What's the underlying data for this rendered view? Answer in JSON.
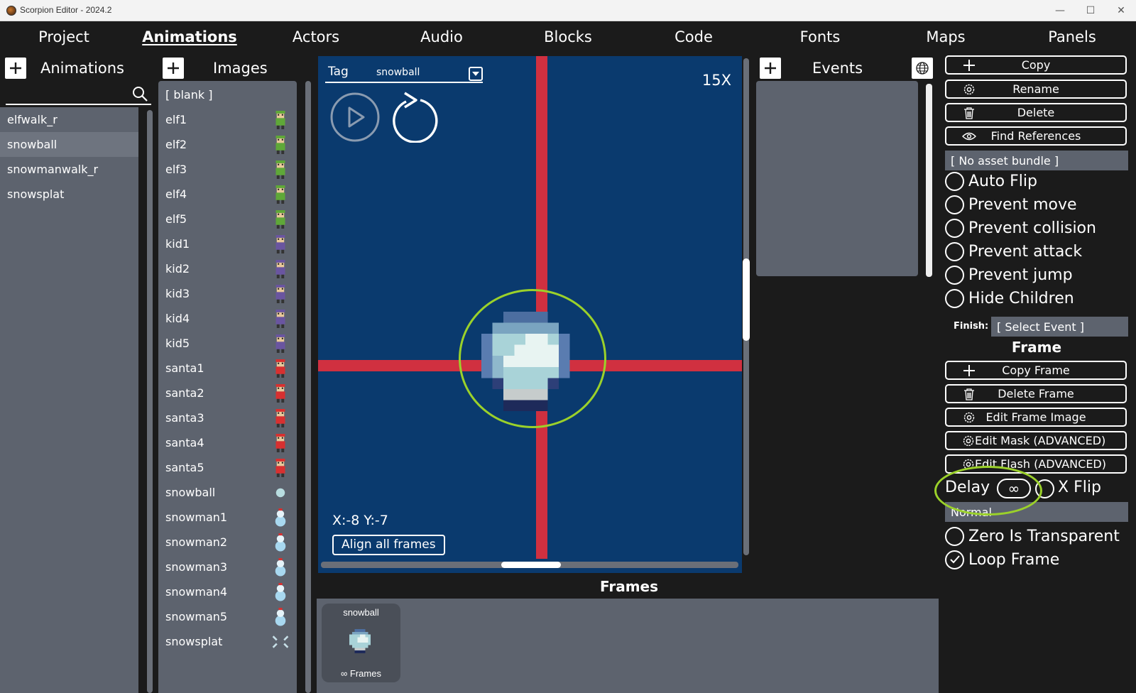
{
  "window": {
    "title": "Scorpion Editor - 2024.2",
    "minimize_glyph": "—",
    "maximize_glyph": "☐",
    "close_glyph": "✕"
  },
  "menu": [
    "Project",
    "Animations",
    "Actors",
    "Audio",
    "Blocks",
    "Code",
    "Fonts",
    "Maps",
    "Panels"
  ],
  "menu_active": "Animations",
  "animations_panel": {
    "title": "Animations",
    "items": [
      "elfwalk_r",
      "snowball",
      "snowmanwalk_r",
      "snowsplat"
    ],
    "selected": "snowball"
  },
  "images_panel": {
    "title": "Images",
    "items": [
      "[ blank ]",
      "elf1",
      "elf2",
      "elf3",
      "elf4",
      "elf5",
      "kid1",
      "kid2",
      "kid3",
      "kid4",
      "kid5",
      "santa1",
      "santa2",
      "santa3",
      "santa4",
      "santa5",
      "snowball",
      "snowman1",
      "snowman2",
      "snowman3",
      "snowman4",
      "snowman5",
      "snowsplat"
    ],
    "sprite_colors": {
      "elf": "#5fa838",
      "kid": "#6a55a0",
      "santa": "#d83030",
      "snowball": "#b8dde0",
      "snowman": "#a8d8f0",
      "snowsplat": "#c8e0e8"
    }
  },
  "canvas": {
    "tag_label": "Tag",
    "tag_value": "snowball",
    "zoom": "15X",
    "coords": "X:-8 Y:-7",
    "align_button": "Align all frames",
    "bg_color": "#0a3a6e",
    "crosshair_color": "#d03040"
  },
  "events_panel": {
    "title": "Events"
  },
  "actions": {
    "copy": "Copy",
    "rename": "Rename",
    "delete": "Delete",
    "find_references": "Find References",
    "asset_bundle": "[ No asset bundle ]"
  },
  "options": [
    {
      "label": "Auto Flip",
      "checked": false
    },
    {
      "label": "Prevent move",
      "checked": false
    },
    {
      "label": "Prevent collision",
      "checked": false
    },
    {
      "label": "Prevent attack",
      "checked": false
    },
    {
      "label": "Prevent jump",
      "checked": false
    },
    {
      "label": "Hide Children",
      "checked": false
    }
  ],
  "finish": {
    "label": "Finish:",
    "value": "[ Select Event ]"
  },
  "frame_section": {
    "title": "Frame",
    "copy_frame": "Copy Frame",
    "delete_frame": "Delete Frame",
    "edit_frame_image": "Edit Frame Image",
    "edit_mask": "Edit Mask (ADVANCED)",
    "edit_flash": "Edit Flash (ADVANCED)",
    "delay_label": "Delay",
    "delay_value": "∞",
    "xflip_label": "X Flip",
    "blend_mode": "Normal",
    "zero_transparent": {
      "label": "Zero Is Transparent",
      "checked": false
    },
    "loop_frame": {
      "label": "Loop Frame",
      "checked": true
    }
  },
  "frames_panel": {
    "title": "Frames",
    "frame_name": "snowball",
    "frame_info": "∞ Frames"
  },
  "highlight_color": "#9bd12a"
}
